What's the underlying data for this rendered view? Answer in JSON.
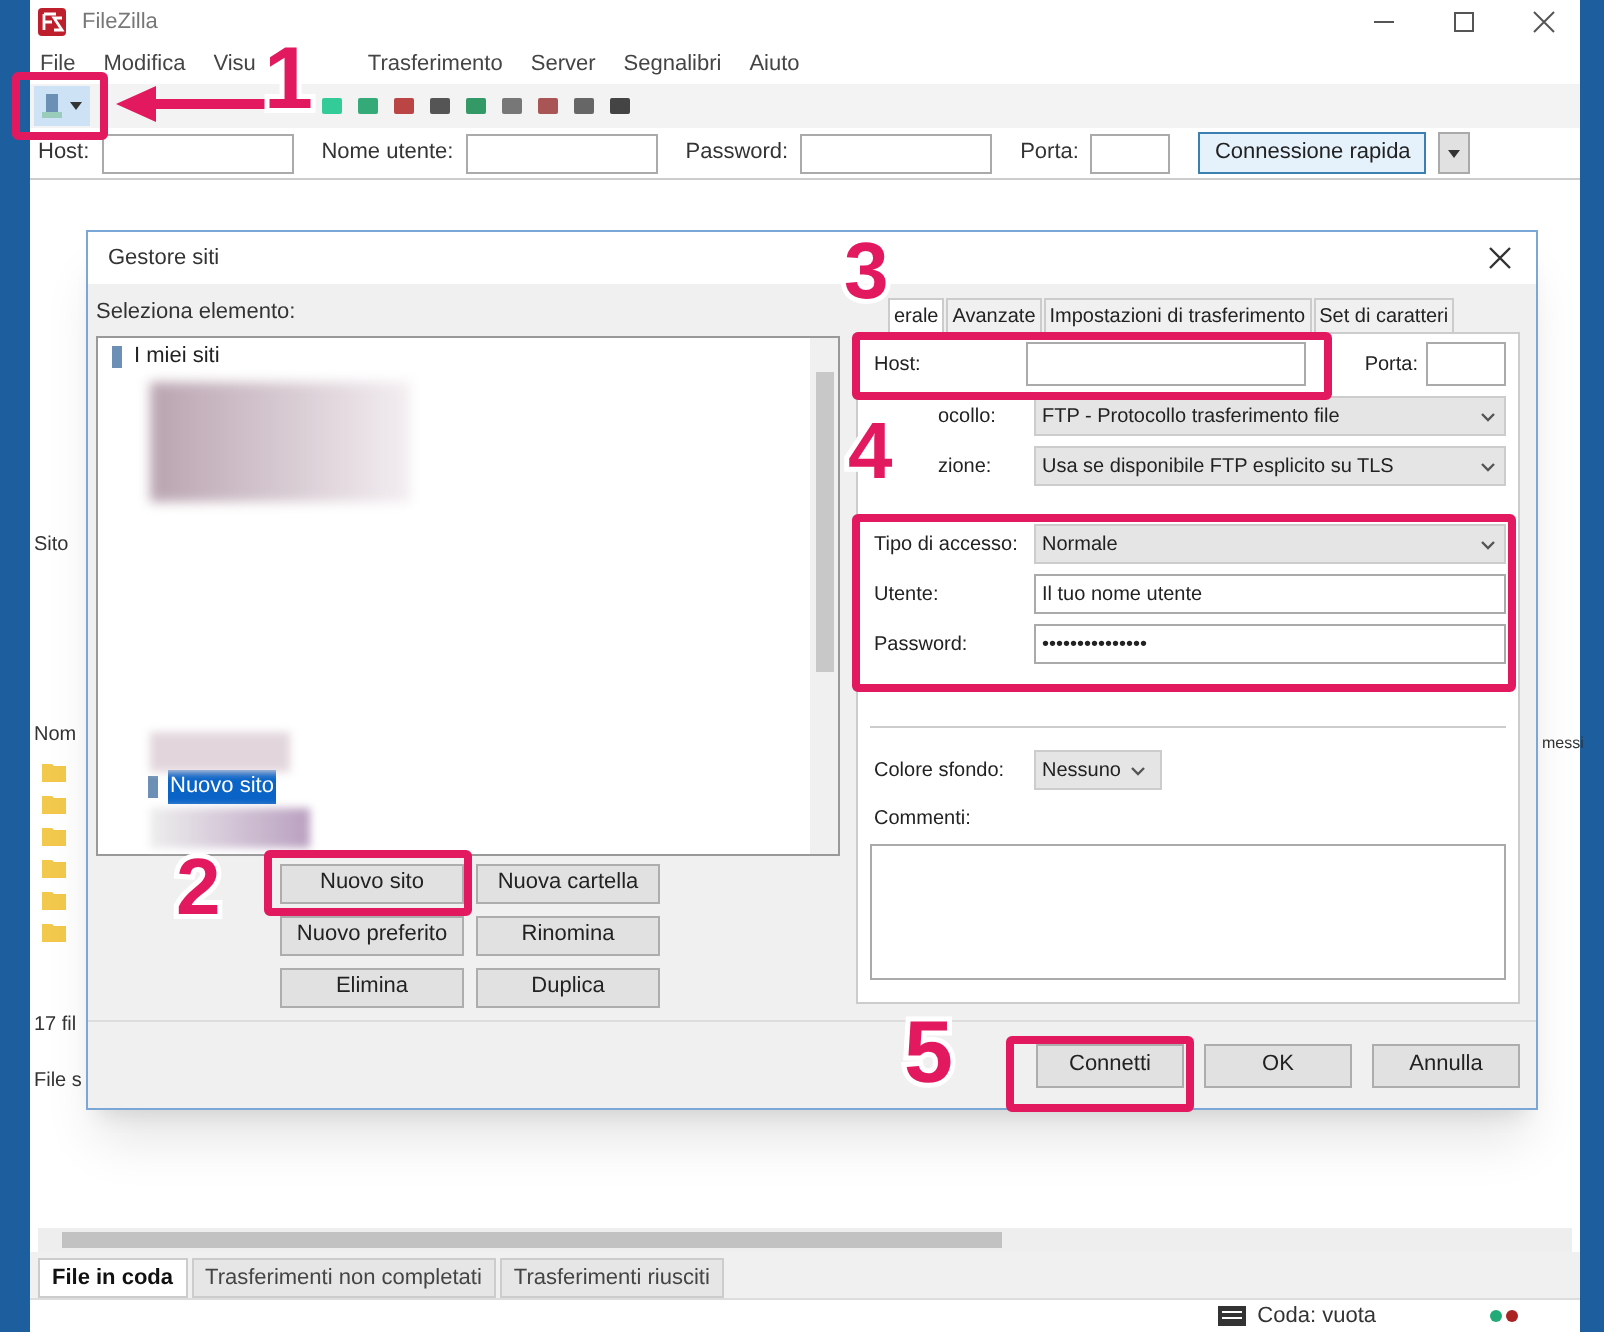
{
  "window": {
    "title": "FileZilla"
  },
  "menu": [
    "File",
    "Modifica",
    "Visu",
    "Trasferimento",
    "Server",
    "Segnalibri",
    "Aiuto"
  ],
  "quickconnect": {
    "fields": [
      {
        "label": "Host:"
      },
      {
        "label": "Nome utente:"
      },
      {
        "label": "Password:"
      },
      {
        "label": "Porta:"
      }
    ],
    "button": "Connessione rapida"
  },
  "background_texts": [
    {
      "text": "Sito"
    },
    {
      "text": "Nom"
    },
    {
      "text": "17 fil"
    },
    {
      "text": "File s"
    },
    {
      "text": "messi"
    }
  ],
  "dialog": {
    "title": "Gestore siti",
    "tree_label": "Seleziona elemento:",
    "tree": [
      {
        "label": "I miei siti",
        "selected": false,
        "children": [
          {
            "label": "Nuovo sito",
            "selected": true
          }
        ]
      }
    ],
    "site_buttons": [
      "Nuovo sito",
      "Nuova cartella",
      "Nuovo preferito",
      "Rinomina",
      "Elimina",
      "Duplica"
    ],
    "tabs": [
      {
        "label": "erale",
        "selected": true
      },
      {
        "label": "Avanzate",
        "selected": false
      },
      {
        "label": "Impostazioni di trasferimento",
        "selected": false
      },
      {
        "label": "Set di caratteri",
        "selected": false
      }
    ],
    "host": {
      "label": "Host:",
      "port_label": "Porta:"
    },
    "fields": [
      {
        "kind": "select",
        "label": "ocollo:",
        "value": "FTP - Protocollo trasferimento file"
      },
      {
        "kind": "select",
        "label": "zione:",
        "value": "Usa se disponibile FTP esplicito su TLS"
      },
      {
        "kind": "select",
        "label": "Tipo di accesso:",
        "value": "Normale"
      },
      {
        "kind": "input",
        "label": "Utente:",
        "value": "Il tuo nome utente"
      },
      {
        "kind": "input",
        "label": "Password:",
        "value": "•••••••••••••••"
      }
    ],
    "background_color": {
      "label": "Colore sfondo:",
      "value": "Nessuno"
    },
    "comments_label": "Commenti:",
    "footer_buttons": [
      "Connetti",
      "OK",
      "Annulla"
    ]
  },
  "annotations": [
    "1",
    "2",
    "3",
    "4",
    "5"
  ],
  "bottom_tabs": [
    {
      "label": "File in coda",
      "selected": true
    },
    {
      "label": "Trasferimenti non completati",
      "selected": false
    },
    {
      "label": "Trasferimenti riusciti",
      "selected": false
    }
  ],
  "status": "Coda: vuota"
}
